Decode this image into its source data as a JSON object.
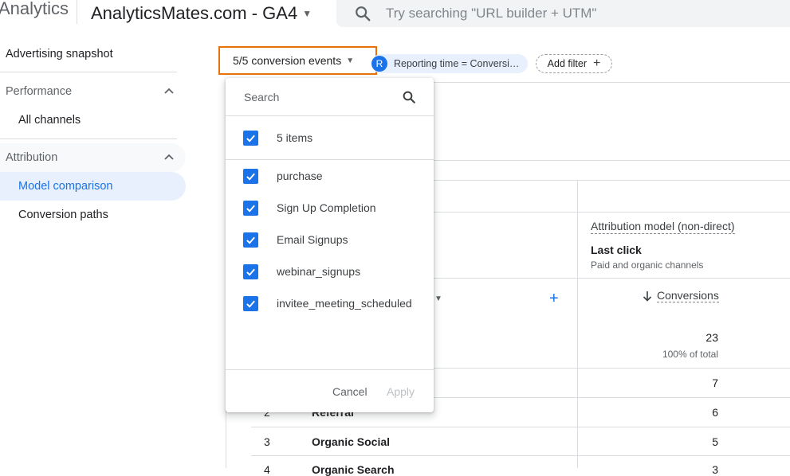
{
  "header": {
    "brand": "Analytics",
    "account": "AnalyticsMates.com - GA4",
    "search_placeholder": "Try searching \"URL builder + UTM\""
  },
  "sidebar": {
    "items": [
      {
        "label": "Advertising snapshot"
      },
      {
        "label": "Performance"
      },
      {
        "label": "All channels"
      },
      {
        "label": "Attribution"
      },
      {
        "label": "Model comparison"
      },
      {
        "label": "Conversion paths"
      }
    ]
  },
  "filters": {
    "conversion_selector": "5/5 conversion events",
    "chip_badge": "R",
    "chip_label": "Reporting time = Conversi…",
    "add_filter": "Add filter"
  },
  "table": {
    "column_group_label": "Attribution model (non-direct)",
    "model_name": "Last click",
    "model_sub": "Paid and organic channels",
    "metric_label": "Conversions",
    "total": "23",
    "total_pct": "100% of total",
    "rows": [
      {
        "num": "",
        "name": "",
        "value": "7"
      },
      {
        "num": "2",
        "name": "Referral",
        "value": "6"
      },
      {
        "num": "3",
        "name": "Organic Social",
        "value": "5"
      },
      {
        "num": "4",
        "name": "Organic Search",
        "value": "3"
      }
    ]
  },
  "dropdown": {
    "search_placeholder": "Search",
    "select_all": "5 items",
    "items": [
      {
        "label": "purchase",
        "checked": true
      },
      {
        "label": "Sign Up Completion",
        "checked": true
      },
      {
        "label": "Email Signups",
        "checked": true
      },
      {
        "label": "webinar_signups",
        "checked": true
      },
      {
        "label": "invitee_meeting_scheduled",
        "checked": true
      }
    ],
    "cancel": "Cancel",
    "apply": "Apply"
  },
  "colors": {
    "accent": "#1a73e8",
    "highlight_border": "#e8710a"
  }
}
